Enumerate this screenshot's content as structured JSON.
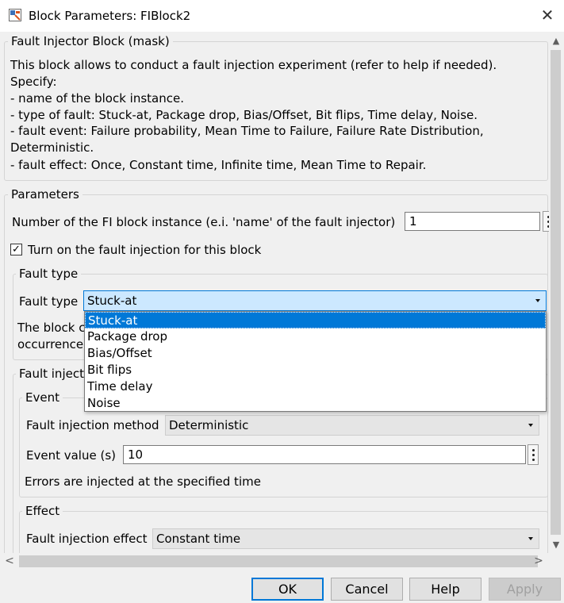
{
  "window": {
    "title": "Block Parameters: FIBlock2",
    "close_glyph": "✕"
  },
  "mask": {
    "title": "Fault Injector Block (mask)",
    "description": [
      "This block allows to conduct a fault injection experiment (refer to help if needed).",
      "Specify:",
      "- name of the block instance.",
      "- type of fault: Stuck-at, Package drop, Bias/Offset, Bit flips, Time delay, Noise.",
      "- fault event: Failure probability, Mean Time to Failure, Failure Rate Distribution,",
      "Deterministic.",
      "- fault effect: Once, Constant time, Infinite time, Mean Time to Repair."
    ]
  },
  "parameters": {
    "title": "Parameters",
    "instance_label": "Number of the FI block instance (e.i. 'name' of the fault injector)",
    "instance_value": "1",
    "turn_on_label": "Turn on the fault injection for this block",
    "turn_on_checked": true,
    "turn_on_checkmark": "✓"
  },
  "fault_type_group": {
    "title": "Fault type",
    "label": "Fault type",
    "selected": "Stuck-at",
    "options": [
      "Stuck-at",
      "Package drop",
      "Bias/Offset",
      "Bit flips",
      "Time delay",
      "Noise"
    ],
    "desc_line1_partial": "The block c",
    "desc_line2_partial": "occurrence."
  },
  "fault_injection_group": {
    "title_partial": "Fault inject",
    "event": {
      "title": "Event",
      "method_label": "Fault injection method",
      "method_value": "Deterministic",
      "value_label": "Event value (s)",
      "value": "10",
      "info": "Errors are injected at the specified time"
    },
    "effect": {
      "title": "Effect",
      "effect_label": "Fault injection effect",
      "effect_value": "Constant time"
    }
  },
  "scrollbars": {
    "up": "▲",
    "down": "▼",
    "left": "<",
    "right": ">"
  },
  "buttons": {
    "ok": "OK",
    "cancel": "Cancel",
    "help": "Help",
    "apply": "Apply"
  },
  "colors": {
    "accent": "#0078d7",
    "selected_option": "#0078d7",
    "selected_combo": "#cce8ff"
  }
}
